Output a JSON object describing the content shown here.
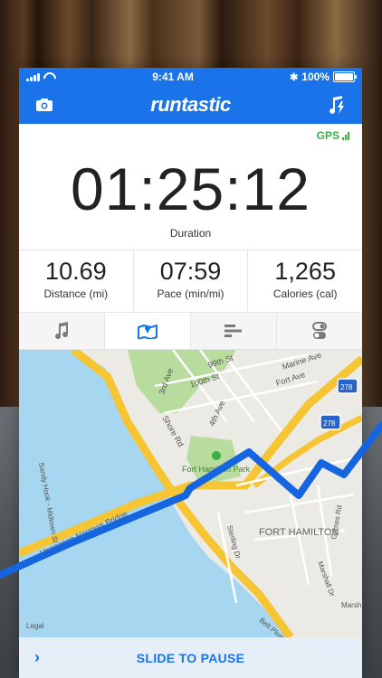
{
  "status_bar": {
    "time": "9:41 AM",
    "battery": "100%"
  },
  "app": {
    "name": "runtastic"
  },
  "gps": {
    "label": "GPS"
  },
  "timer": {
    "value": "01:25:12",
    "label": "Duration"
  },
  "stats": [
    {
      "value": "10.69",
      "label": "Distance (mi)"
    },
    {
      "value": "07:59",
      "label": "Pace (min/mi)"
    },
    {
      "value": "1,265",
      "label": "Calories (cal)"
    }
  ],
  "tabs": [
    {
      "name": "music",
      "icon": "music-note-icon"
    },
    {
      "name": "map",
      "icon": "map-icon",
      "active": true
    },
    {
      "name": "stats",
      "icon": "bars-icon"
    },
    {
      "name": "settings",
      "icon": "toggle-icon"
    }
  ],
  "map": {
    "labels": {
      "ave_99": "99th St",
      "ave_3rd": "3rd Ave",
      "st_100": "100th St",
      "marine": "Marine Ave",
      "fort_ave": "Fort Ave",
      "ave_4th": "4th Ave",
      "shore": "Shore Rd",
      "park": "Fort Hamilton Park",
      "fort_hamilton": "FORT HAMILTON",
      "sterling": "Sterling Dr",
      "marshall": "Marshall Dr",
      "grimes": "Grimes Rd",
      "bridge": "Verrazano Narrows Bridge",
      "sandy_hook": "Sandy Hook - Midtown St",
      "belt": "Belt Pkwy",
      "marsh": "Marsh",
      "legal": "Legal",
      "hw278": "278"
    }
  },
  "bottom": {
    "slide_label": "SLIDE TO PAUSE",
    "chevron": "›"
  }
}
